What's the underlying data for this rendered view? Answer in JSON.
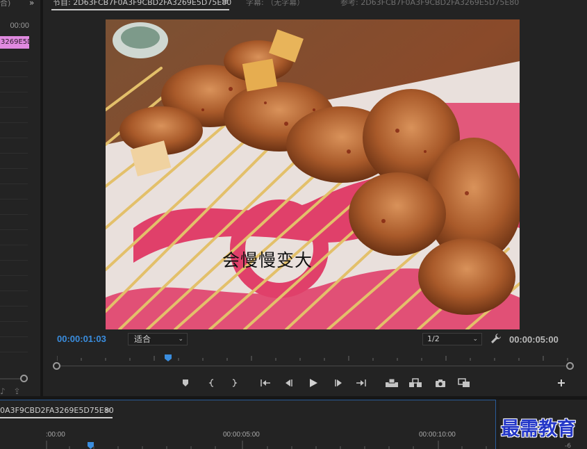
{
  "left_panel": {
    "title": "合​)",
    "timecode": "00:00",
    "clip_label": "3269E5D",
    "icons": [
      "music-note-icon",
      "share-icon"
    ]
  },
  "monitor": {
    "tabs": [
      {
        "label": "节目: 2D63FCB7F0A3F9CBD2FA3269E5D75E80",
        "active": true
      },
      {
        "label": "字幕: （无字幕）",
        "active": false
      },
      {
        "label": "参考: 2D63FCB7F0A3F9CBD2FA3269E5D75E80",
        "active": false
      }
    ],
    "menu_icon": "≡",
    "video_caption": "会慢慢变大",
    "current_timecode": "00:00:01:03",
    "zoom_value": "适合",
    "quality_value": "1/2",
    "duration": "00:00:05:00",
    "transport": [
      "add-marker-icon",
      "mark-in-icon",
      "mark-out-icon",
      "go-to-in-icon",
      "step-back-icon",
      "play-icon",
      "step-forward-icon",
      "go-to-out-icon",
      "lift-icon",
      "extract-icon",
      "export-frame-icon",
      "comparison-view-icon",
      "add-button-icon"
    ]
  },
  "timeline": {
    "sequence_tab": "0A3F9CBD2FA3269E5D75E80",
    "menu_icon": "≡",
    "ruler_labels": [
      ":00:00",
      "00:00:05:00",
      "00:00:10:00"
    ]
  },
  "right_panel": {
    "watermark": "最需教育",
    "meter_label": "-6"
  },
  "colors": {
    "accent_blue": "#3a8dde",
    "clip_pink": "#e08ae0",
    "panel_bg": "#232323",
    "watermark_blue": "#2437c8"
  }
}
